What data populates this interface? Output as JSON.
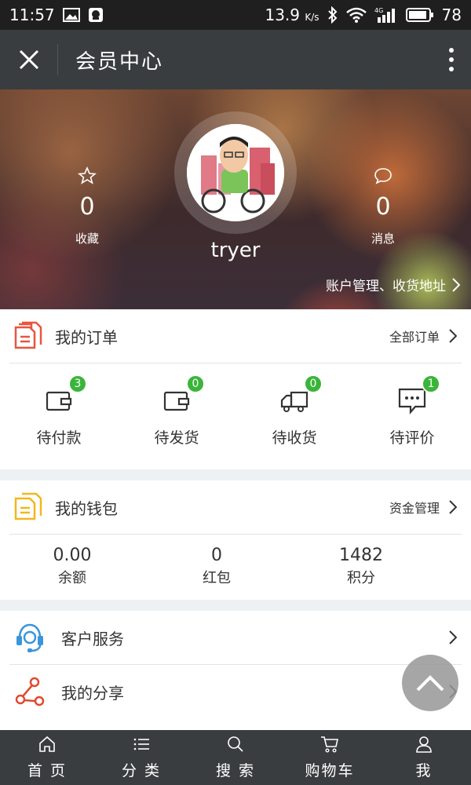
{
  "status_bar": {
    "time": "11:57",
    "speed": "13.9",
    "speed_unit": "K/s",
    "network": "4G",
    "battery": "78"
  },
  "nav": {
    "title": "会员中心"
  },
  "profile": {
    "favorites_count": "0",
    "favorites_label": "收藏",
    "messages_count": "0",
    "messages_label": "消息",
    "username": "tryer",
    "account_link": "账户管理、收货地址"
  },
  "orders": {
    "title": "我的订单",
    "all_link": "全部订单",
    "items": [
      {
        "label": "待付款",
        "count": "3"
      },
      {
        "label": "待发货",
        "count": "0"
      },
      {
        "label": "待收货",
        "count": "0"
      },
      {
        "label": "待评价",
        "count": "1"
      }
    ]
  },
  "wallet": {
    "title": "我的钱包",
    "manage_link": "资金管理",
    "items": [
      {
        "value": "0.00",
        "label": "余额"
      },
      {
        "value": "0",
        "label": "红包"
      },
      {
        "value": "1482",
        "label": "积分"
      }
    ]
  },
  "services": {
    "items": [
      {
        "label": "客户服务"
      },
      {
        "label": "我的分享"
      }
    ]
  },
  "bottom_nav": {
    "tabs": [
      {
        "label": "首 页",
        "icon": "home-icon"
      },
      {
        "label": "分 类",
        "icon": "list-icon"
      },
      {
        "label": "搜 索",
        "icon": "search-icon"
      },
      {
        "label": "购物车",
        "icon": "cart-icon"
      },
      {
        "label": "我",
        "icon": "user-icon"
      }
    ]
  },
  "colors": {
    "green_badge": "#3ab53a",
    "order_icon_red": "#e8553f",
    "wallet_icon_yellow": "#f1b81d",
    "service_icon_blue": "#3a95d9",
    "share_icon_red": "#e04a2f",
    "dark_bar": "#3a3d3f"
  }
}
